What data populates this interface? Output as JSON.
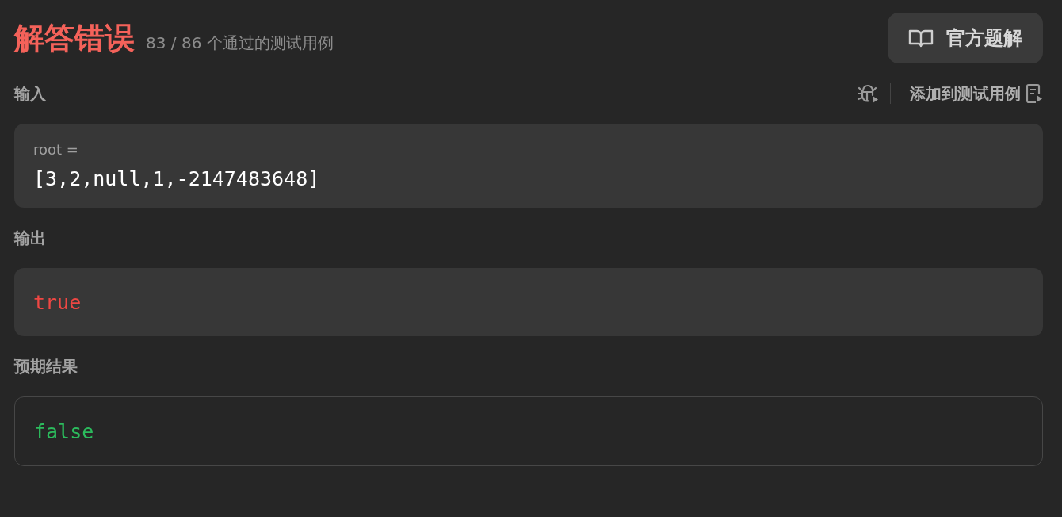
{
  "result": {
    "title": "解答错误",
    "summary": "83 / 86 个通过的测试用例"
  },
  "solution_button": {
    "label": "官方题解"
  },
  "sections": [
    {
      "label": "输入",
      "kind": "input",
      "actions": {
        "add_label": "添加到测试用例"
      },
      "fields": [
        {
          "name": "root =",
          "value": "[3,2,null,1,-2147483648]"
        }
      ]
    },
    {
      "label": "输出",
      "kind": "wrong",
      "fields": [
        {
          "value": "true"
        }
      ]
    },
    {
      "label": "预期结果",
      "kind": "expected",
      "fields": [
        {
          "value": "false"
        }
      ]
    }
  ]
}
